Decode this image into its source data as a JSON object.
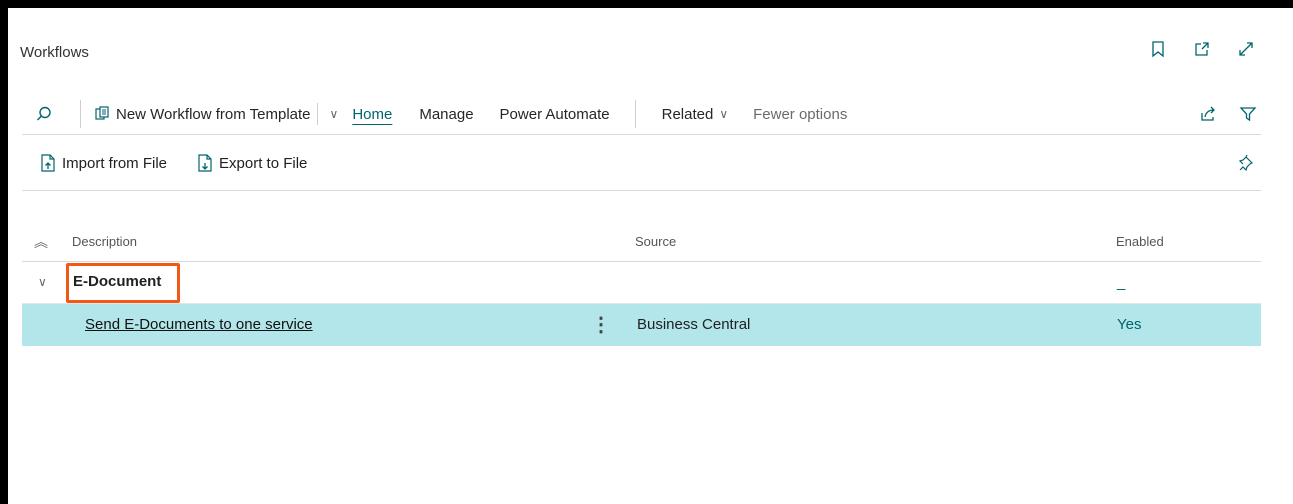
{
  "page": {
    "title": "Workflows"
  },
  "title_icons": [
    "bookmark-icon",
    "open-new-window-icon",
    "expand-icon"
  ],
  "action_bar": {
    "search_icon": "search-icon",
    "new_from_template": "New Workflow from Template",
    "tabs": [
      "Home",
      "Manage",
      "Power Automate"
    ],
    "related": "Related",
    "fewer_options": "Fewer options"
  },
  "sub_bar": {
    "import_label": "Import from File",
    "export_label": "Export to File"
  },
  "grid": {
    "columns": {
      "description": "Description",
      "source": "Source",
      "enabled": "Enabled"
    },
    "group": {
      "label": "E-Document",
      "enabled": "_"
    },
    "rows": [
      {
        "description": "Send E-Documents to one service",
        "source": "Business Central",
        "enabled": "Yes"
      }
    ]
  },
  "colors": {
    "accent": "#00656b",
    "selected_row": "#b3e6ea",
    "highlight": "#f05a14"
  }
}
